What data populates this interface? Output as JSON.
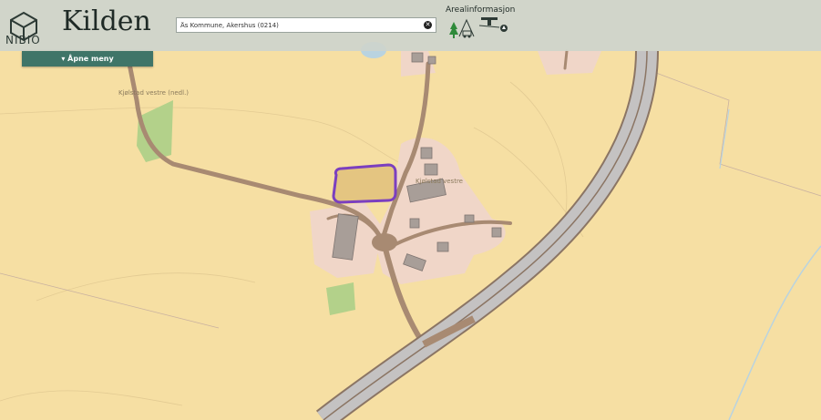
{
  "header": {
    "logo_text": "NIBIO",
    "app_title": "Kilden"
  },
  "search": {
    "value": "Ås Kommune, Akershus (0214)"
  },
  "area_info": {
    "title": "Arealinformasjon",
    "icons": [
      "forest-icon",
      "farm-icon",
      "drone-icon",
      "compass-icon"
    ]
  },
  "menu": {
    "label": "Åpne meny",
    "icon": "caret-down-icon"
  },
  "map": {
    "labels": {
      "farm_old": "Kjølstad vestre (nedl.)",
      "farm": "Kjølstad vestre"
    },
    "colors": {
      "background": "#f6dfa3",
      "settlement": "#f0d6c8",
      "road": "#a88a72",
      "motorway": "#c4c2c2",
      "green": "#b3d18a",
      "highlight": "#7b3fbf"
    }
  }
}
